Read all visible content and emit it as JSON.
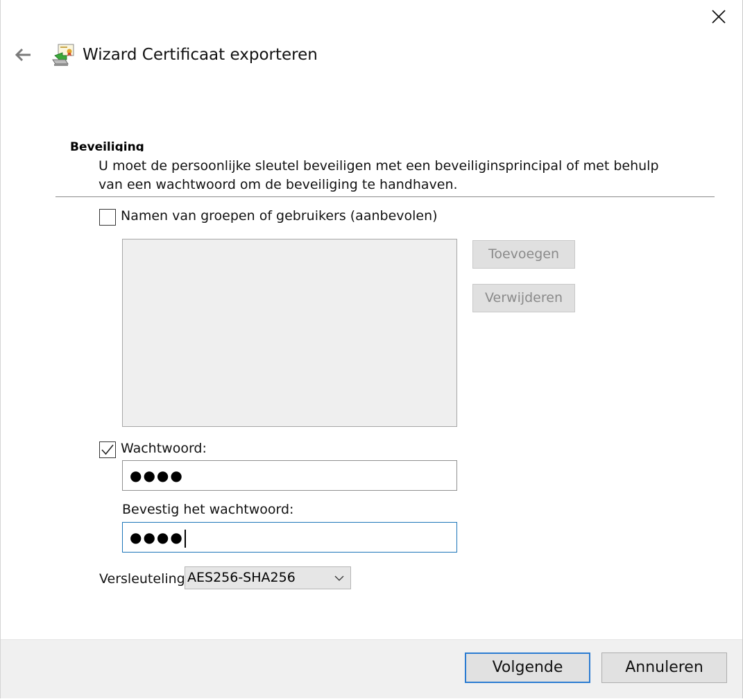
{
  "window": {
    "title": "Wizard Certificaat exporteren"
  },
  "section": {
    "heading": "Beveiliging",
    "description": "U moet de persoonlijke sleutel beveiligen met een beveiliginsprincipal of met behulp van een wachtwoord om de beveiliging te handhaven."
  },
  "groups": {
    "checkbox_label": "Namen van groepen of gebruikers (aanbevolen)",
    "checked": false,
    "add_label": "Toevoegen",
    "remove_label": "Verwijderen"
  },
  "password": {
    "checkbox_label": "Wachtwoord:",
    "checked": true,
    "value_masked": "●●●●",
    "confirm_label": "Bevestig het wachtwoord:",
    "confirm_value_masked": "●●●●"
  },
  "encryption": {
    "label": "Versleuteling",
    "selected": "AES256-SHA256"
  },
  "footer": {
    "next_label": "Volgende",
    "cancel_label": "Annuleren"
  },
  "icons": {
    "back": "back-arrow-icon",
    "close": "close-icon",
    "wizard": "certificate-wizard-icon",
    "dropdown": "chevron-down-icon",
    "check": "checkmark-icon"
  },
  "colors": {
    "focus_border": "#1b74b8",
    "primary_button_border": "#2a7bd1",
    "footer_background": "#f0f0f0",
    "disabled_text": "#8a8a8a"
  }
}
